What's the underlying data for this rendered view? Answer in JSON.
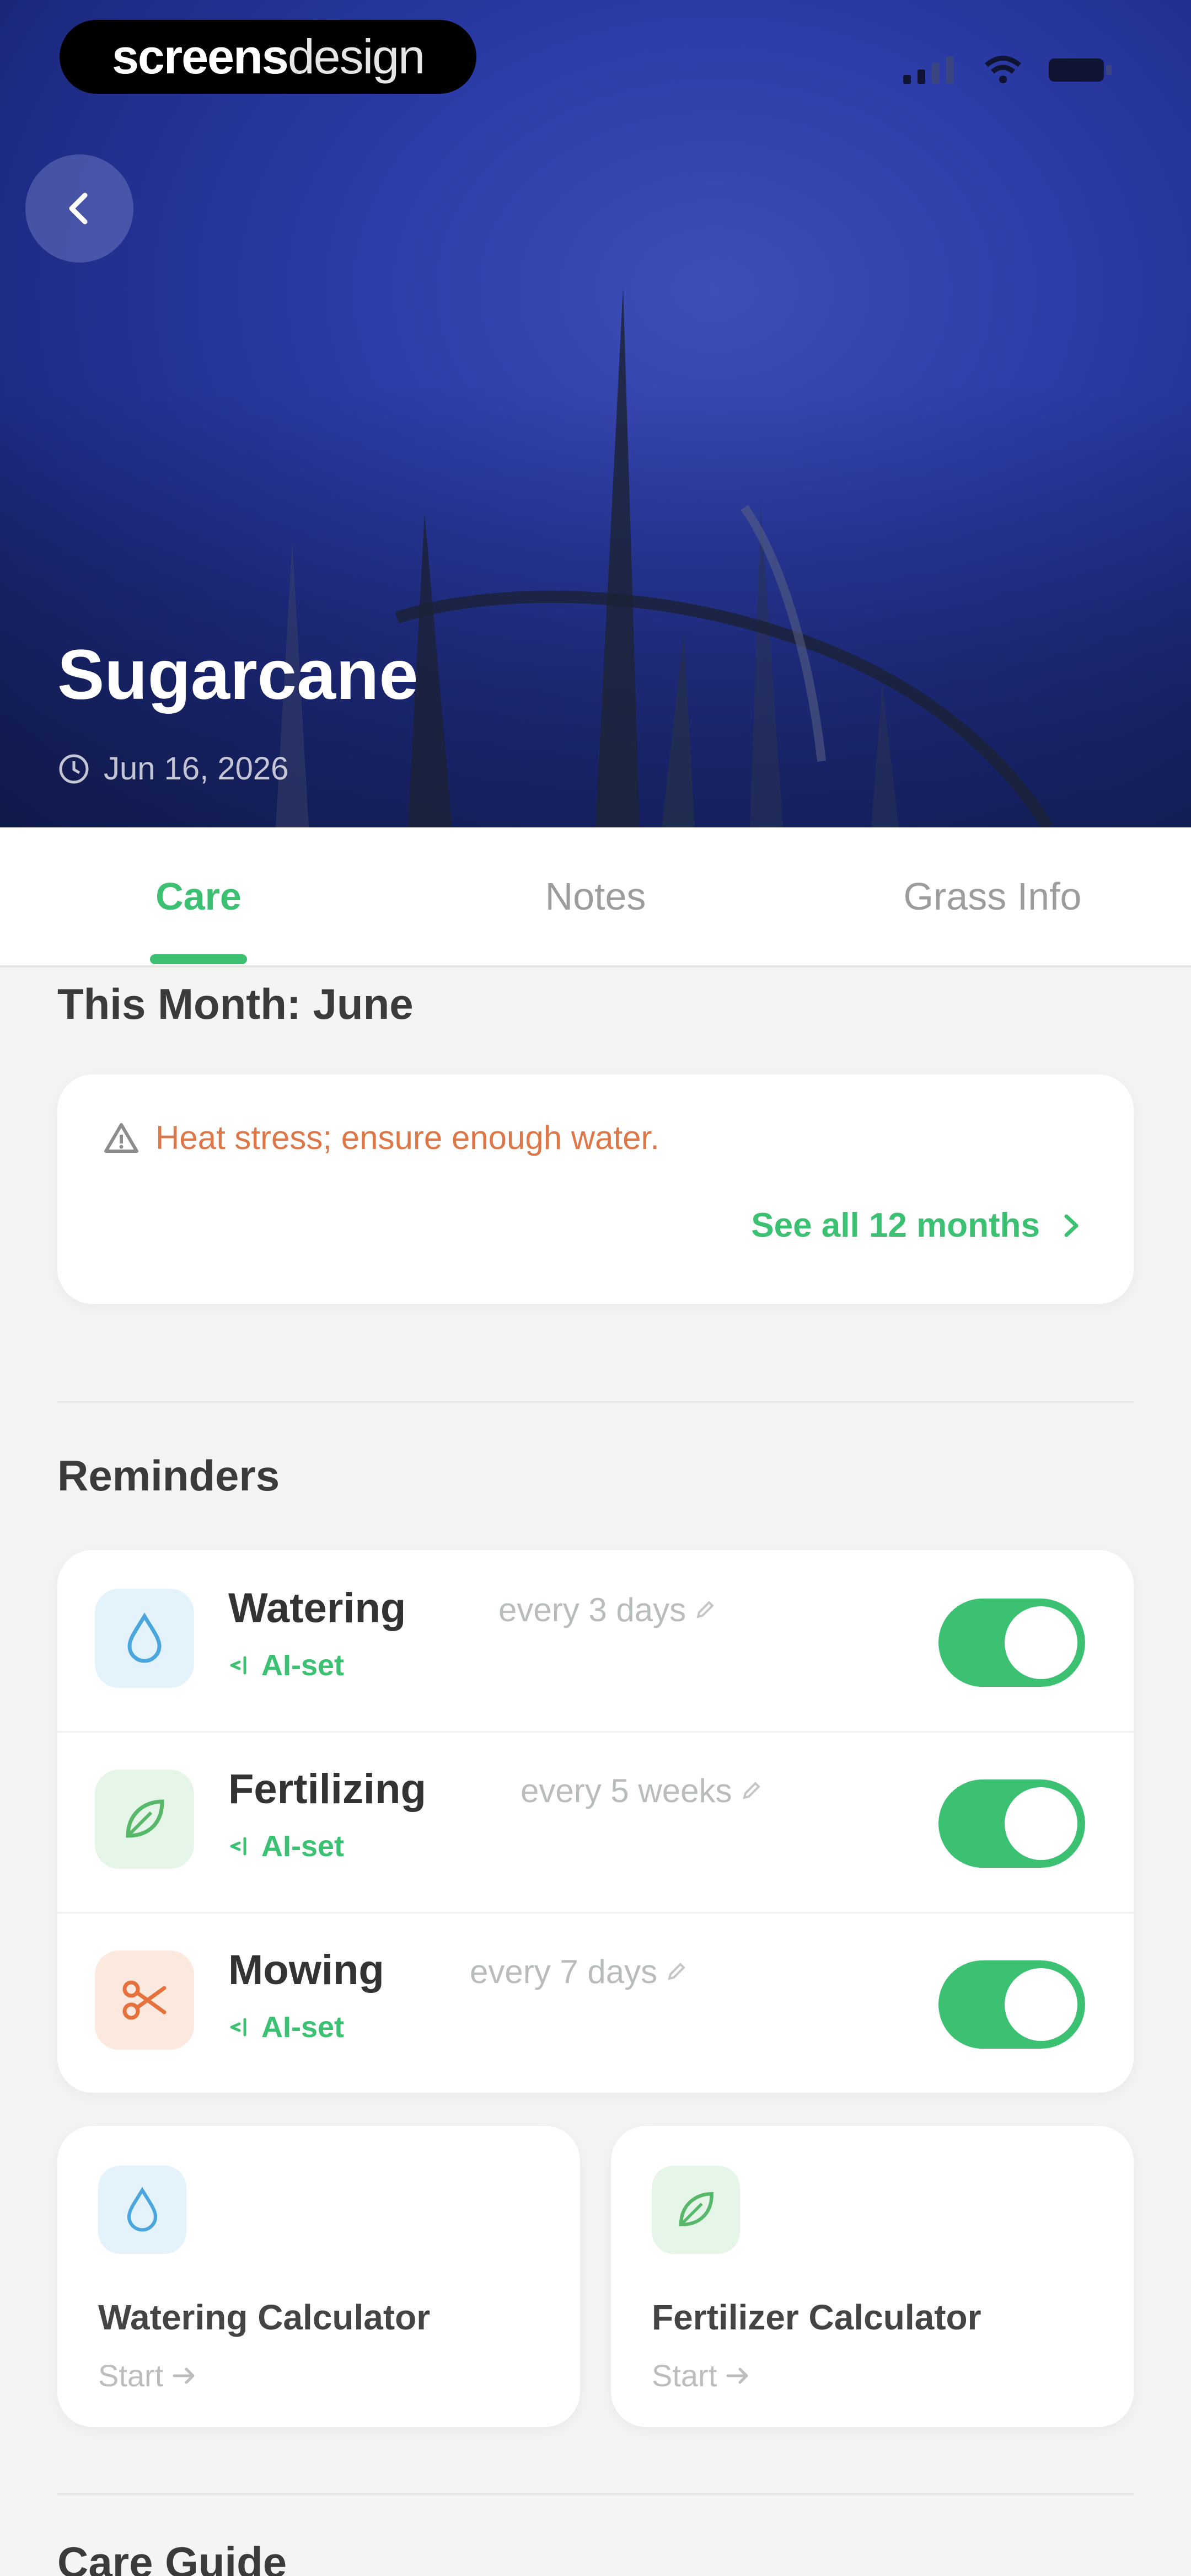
{
  "brand": {
    "bold": "screens",
    "light": "design"
  },
  "plant": {
    "name": "Sugarcane",
    "date": "Jun 16, 2026"
  },
  "tabs": [
    {
      "label": "Care",
      "active": true
    },
    {
      "label": "Notes",
      "active": false
    },
    {
      "label": "Grass Info",
      "active": false
    }
  ],
  "month": {
    "title": "This Month: June",
    "alert": "Heat stress; ensure enough water.",
    "see_all": "See all 12 months"
  },
  "reminders": {
    "title": "Reminders",
    "items": [
      {
        "name": "Watering",
        "frequency": "every 3 days",
        "badge": "AI-set",
        "enabled": true,
        "icon": "water-drop-icon",
        "color": "#4aa6dd",
        "bg": "#e4f3fb"
      },
      {
        "name": "Fertilizing",
        "frequency": "every 5 weeks",
        "badge": "AI-set",
        "enabled": true,
        "icon": "leaf-icon",
        "color": "#57b86a",
        "bg": "#e5f5e7"
      },
      {
        "name": "Mowing",
        "frequency": "every 7 days",
        "badge": "AI-set",
        "enabled": true,
        "icon": "scissors-icon",
        "color": "#e6713c",
        "bg": "#fbe9df"
      }
    ]
  },
  "calculators": [
    {
      "title": "Watering Calculator",
      "action": "Start",
      "icon": "water-drop-icon",
      "color": "#4aa6dd",
      "bg": "#e4f3fb"
    },
    {
      "title": "Fertilizer Calculator",
      "action": "Start",
      "icon": "leaf-icon",
      "color": "#57b86a",
      "bg": "#e5f5e7"
    }
  ],
  "care_guide": {
    "title": "Care Guide"
  },
  "colors": {
    "accent": "#3cc173",
    "alert": "#dd7747"
  }
}
